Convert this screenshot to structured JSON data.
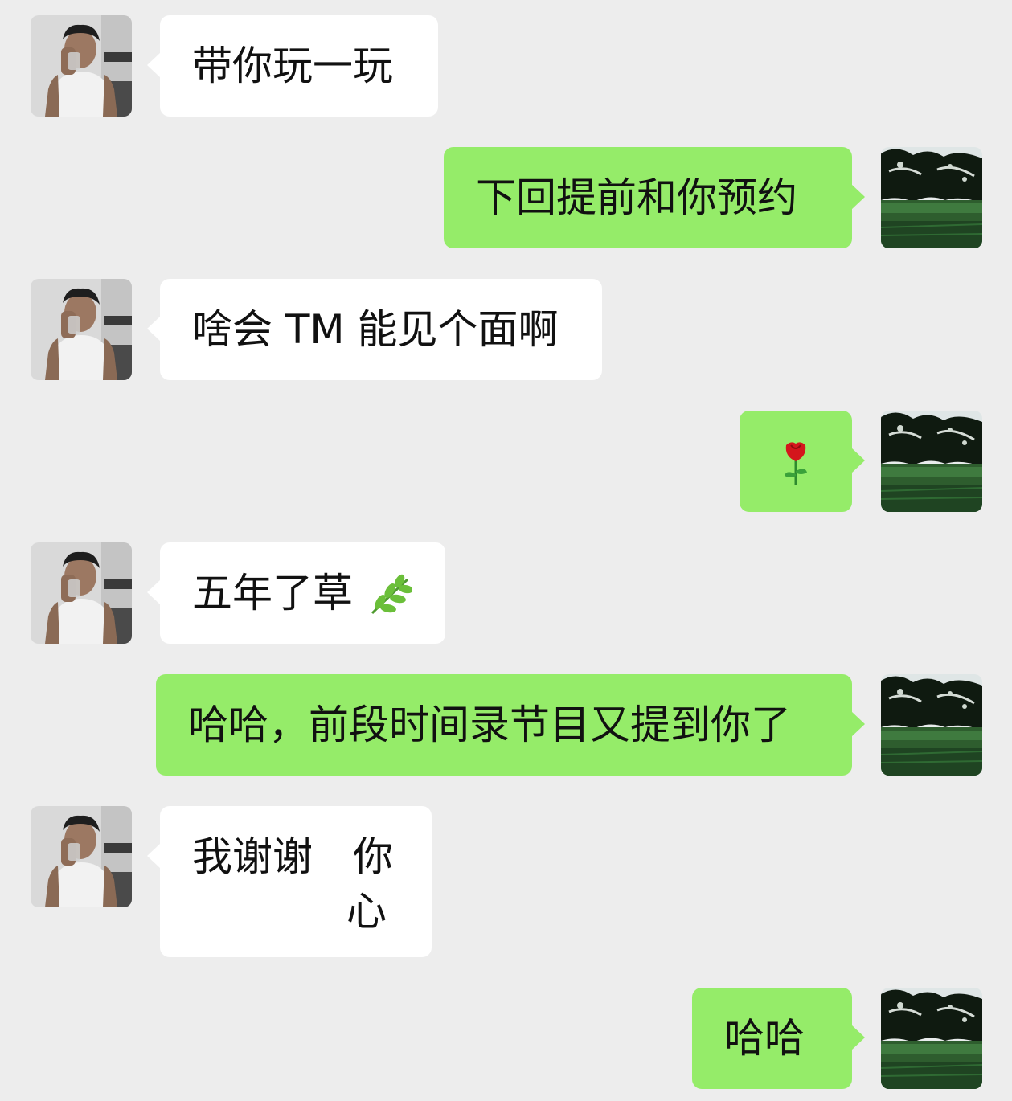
{
  "conversation": {
    "messages": [
      {
        "side": "in",
        "text": "带你玩一玩"
      },
      {
        "side": "out",
        "text": "下回提前和你预约"
      },
      {
        "side": "in",
        "text": "啥会 TM 能见个面啊"
      },
      {
        "side": "out",
        "emoji": "rose-emoji"
      },
      {
        "side": "in",
        "text": "五年了草",
        "emoji": "herb-emoji"
      },
      {
        "side": "out",
        "text": "哈哈，前段时间录节目又提到你了"
      },
      {
        "side": "in",
        "line1": "我谢谢　你",
        "line2": "心"
      },
      {
        "side": "out",
        "text": "哈哈"
      }
    ]
  },
  "colors": {
    "background": "#ededed",
    "incoming_bubble": "#ffffff",
    "outgoing_bubble": "#95ec69",
    "text": "#111111"
  }
}
